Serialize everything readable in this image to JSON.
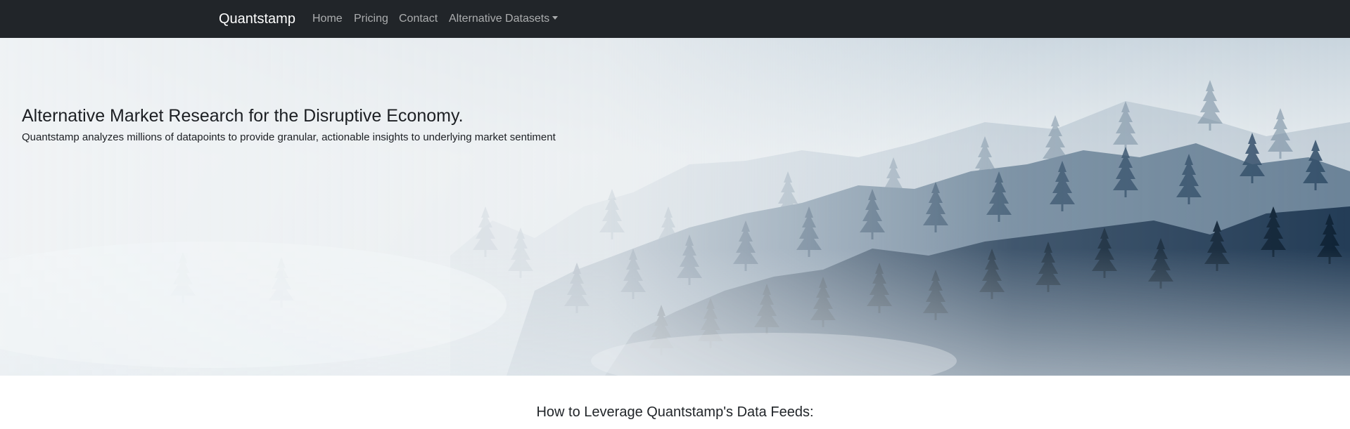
{
  "navbar": {
    "brand": "Quantstamp",
    "items": [
      {
        "label": "Home"
      },
      {
        "label": "Pricing"
      },
      {
        "label": "Contact"
      },
      {
        "label": "Alternative Datasets",
        "dropdown": true
      }
    ]
  },
  "hero": {
    "title": "Alternative Market Research for the Disruptive Economy.",
    "subtitle": "Quantstamp analyzes millions of datapoints to provide granular, actionable insights to underlying market sentiment",
    "image": "misty-forest-image"
  },
  "main": {
    "section_heading": "How to Leverage Quantstamp's Data Feeds:"
  },
  "colors": {
    "navbar_bg": "#212529",
    "forest_dark": "#12263a",
    "forest_mid": "#3a5570",
    "fog": "#eef1f3"
  }
}
